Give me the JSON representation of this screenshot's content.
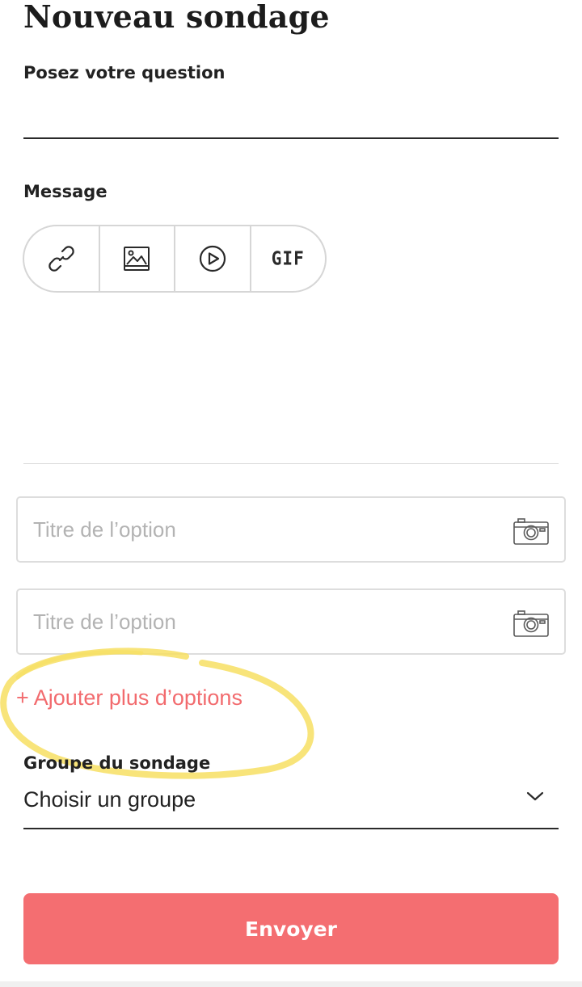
{
  "header": {
    "title": "Nouveau sondage"
  },
  "question": {
    "label": "Posez votre question",
    "value": "",
    "placeholder": ""
  },
  "message": {
    "label": "Message",
    "toolbar": {
      "link_icon": "link-icon",
      "image_icon": "image-icon",
      "video_icon": "play-circle-icon",
      "gif_label": "GIF"
    }
  },
  "options": {
    "items": [
      {
        "value": "",
        "placeholder": "Titre de l’option",
        "icon": "camera-icon"
      },
      {
        "value": "",
        "placeholder": "Titre de l’option",
        "icon": "camera-icon"
      }
    ],
    "add_more_label": "+ Ajouter plus d’options"
  },
  "group": {
    "label": "Groupe du sondage",
    "selected": "Choisir un groupe"
  },
  "submit": {
    "label": "Envoyer"
  },
  "colors": {
    "accent": "#f46e71",
    "link_red": "#f26b6e",
    "highlight": "#f7df63",
    "border": "#dddddd"
  }
}
